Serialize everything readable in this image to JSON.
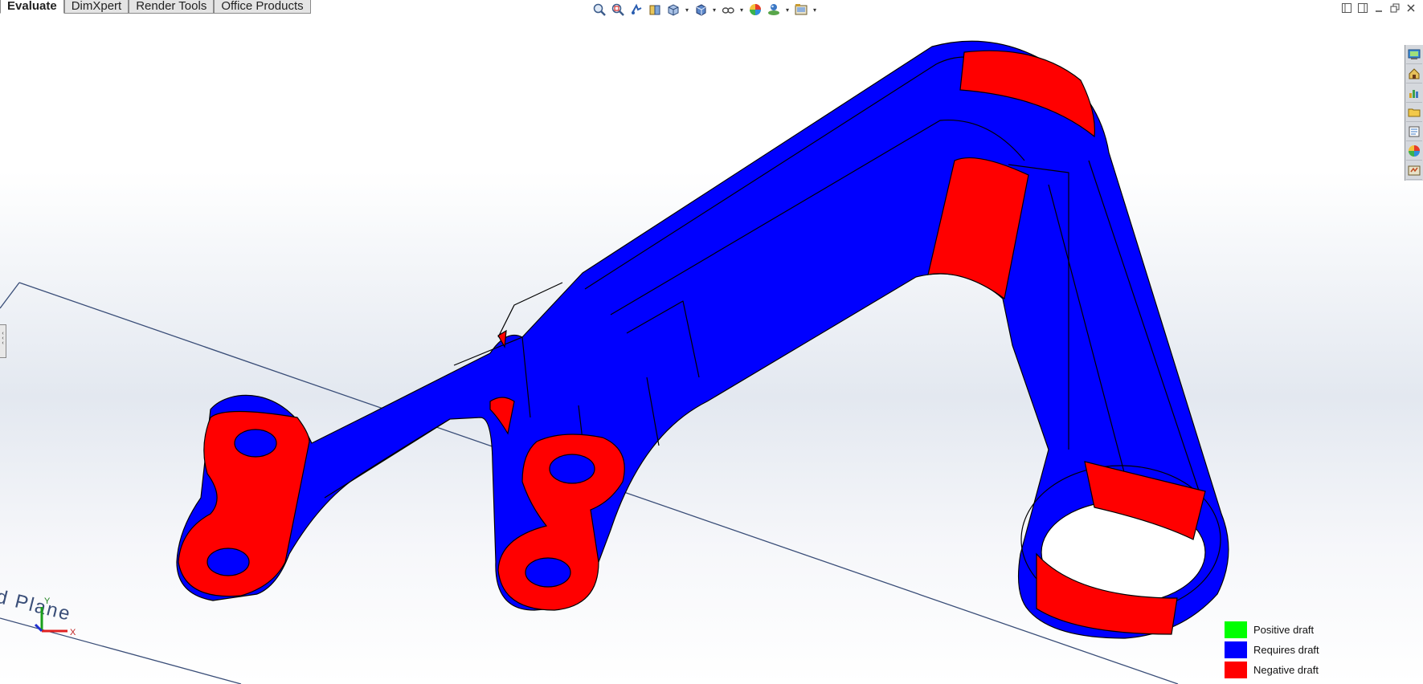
{
  "command_tabs": [
    {
      "label": "Evaluate",
      "active": true
    },
    {
      "label": "DimXpert",
      "active": false
    },
    {
      "label": "Render Tools",
      "active": false
    },
    {
      "label": "Office Products",
      "active": false
    }
  ],
  "heads_up_toolbar": [
    "zoom-to-fit-icon",
    "zoom-to-area-icon",
    "previous-view-icon",
    "section-view-icon",
    "view-orientation-icon",
    "display-style-icon",
    "hide-show-items-icon",
    "edit-appearance-icon",
    "apply-scene-icon",
    "view-settings-icon"
  ],
  "task_pane": [
    "solidworks-resources-icon",
    "design-library-icon",
    "file-explorer-icon",
    "view-palette-icon",
    "appearances-scenes-icon",
    "custom-properties-icon",
    "forum-icon"
  ],
  "plane_label": "d Plane",
  "triad": {
    "x_label": "X",
    "y_label": "Y"
  },
  "legend": [
    {
      "label": "Positive draft",
      "color": "#00ff00"
    },
    {
      "label": "Requires draft",
      "color": "#0000ff"
    },
    {
      "label": "Negative draft",
      "color": "#ff0000"
    }
  ],
  "colors": {
    "requires_draft": "#0000ff",
    "negative_draft": "#ff0000",
    "positive_draft": "#00ff00",
    "plane_line": "#3a4e78"
  }
}
